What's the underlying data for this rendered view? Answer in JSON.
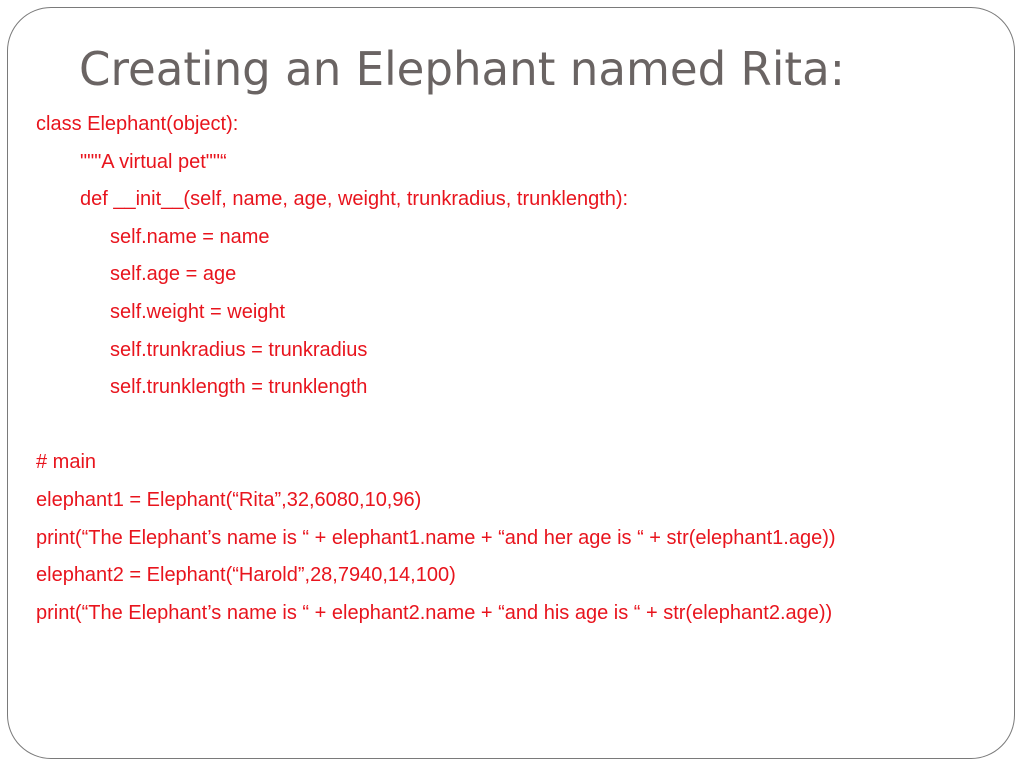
{
  "slide": {
    "title": "Creating an Elephant named Rita:",
    "code_lines": [
      {
        "text": "class Elephant(object):",
        "indent": 0
      },
      {
        "text": "\"\"\"A virtual pet\"\"“",
        "indent": 1
      },
      {
        "text": "def __init__(self, name, age, weight, trunkradius, trunklength):",
        "indent": 1
      },
      {
        "text": "self.name = name",
        "indent": 2
      },
      {
        "text": "self.age = age",
        "indent": 2
      },
      {
        "text": "self.weight = weight",
        "indent": 2
      },
      {
        "text": "self.trunkradius = trunkradius",
        "indent": 2
      },
      {
        "text": "self.trunklength = trunklength",
        "indent": 2
      },
      {
        "text": "",
        "indent": 0
      },
      {
        "text": "# main",
        "indent": 0
      },
      {
        "text": "elephant1 = Elephant(“Rita”,32,6080,10,96)",
        "indent": 0
      },
      {
        "text": "print(“The Elephant’s name is “ + elephant1.name + “and her age is “ + str(elephant1.age))",
        "indent": 0
      },
      {
        "text": "elephant2 = Elephant(“Harold”,28,7940,14,100)",
        "indent": 0
      },
      {
        "text": "print(“The Elephant’s name is “ + elephant2.name + “and his age is “ + str(elephant2.age))",
        "indent": 0
      }
    ]
  },
  "colors": {
    "title": "#6a6463",
    "code": "#e8141d",
    "frame_border": "#7a7a7a",
    "background": "#ffffff"
  }
}
